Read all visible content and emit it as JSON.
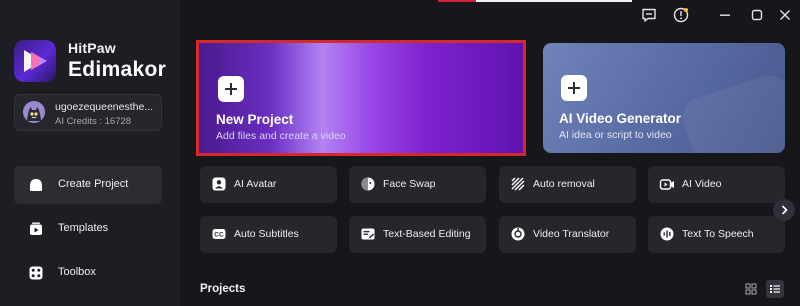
{
  "brand": {
    "line1": "HitPaw",
    "line2": "Edimakor"
  },
  "account": {
    "name": "ugoezequeenesthe...",
    "credits": "AI Credits : 16728"
  },
  "sidebar": {
    "items": [
      {
        "label": "Create Project",
        "icon": "create-project-icon",
        "active": true
      },
      {
        "label": "Templates",
        "icon": "templates-icon",
        "active": false
      },
      {
        "label": "Toolbox",
        "icon": "toolbox-icon",
        "active": false
      }
    ]
  },
  "window_controls": [
    "feedback-icon",
    "notification-icon",
    "minimize-icon",
    "maximize-icon",
    "close-icon"
  ],
  "hero": {
    "new_project": {
      "title": "New Project",
      "subtitle": "Add files and create a video",
      "selected": true
    },
    "ai_video_generator": {
      "title": "AI Video Generator",
      "subtitle": "AI idea or script to video"
    }
  },
  "tools": [
    {
      "label": "AI Avatar",
      "icon": "ai-avatar-icon"
    },
    {
      "label": "Face Swap",
      "icon": "face-swap-icon"
    },
    {
      "label": "Auto removal",
      "icon": "auto-removal-icon"
    },
    {
      "label": "AI Video",
      "icon": "ai-video-icon"
    },
    {
      "label": "Auto Subtitles",
      "icon": "auto-subtitles-icon"
    },
    {
      "label": "Text-Based Editing",
      "icon": "text-based-editing-icon"
    },
    {
      "label": "Video Translator",
      "icon": "video-translator-icon"
    },
    {
      "label": "Text To Speech",
      "icon": "text-to-speech-icon"
    }
  ],
  "projects": {
    "title": "Projects",
    "view_mode": "list"
  },
  "colors": {
    "background": "#16161b",
    "sidebar": "#1d1d23",
    "tile": "#26262c",
    "selection_border": "#d42a2a",
    "new_project_gradient": "#6a2ec2",
    "ai_card": "#5b6ea7"
  }
}
